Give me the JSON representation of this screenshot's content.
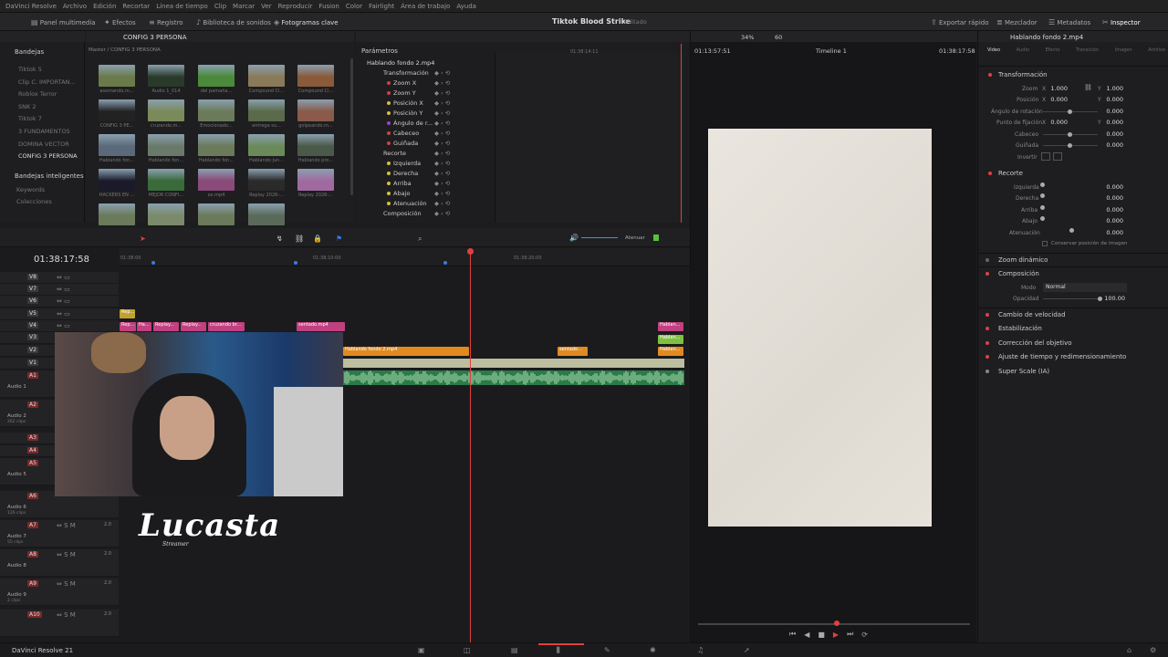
{
  "menu": [
    "DaVinci Resolve",
    "Archivo",
    "Edición",
    "Recortar",
    "Línea de tiempo",
    "Clip",
    "Marcar",
    "Ver",
    "Reproducir",
    "Fusion",
    "Color",
    "Fairlight",
    "Área de trabajo",
    "Ayuda"
  ],
  "topbar": {
    "media_pool": "Panel multimedia",
    "effects": "Efectos",
    "registry": "Registro",
    "sound_library": "Biblioteca de sonidos",
    "keyframes": "Fotogramas clave",
    "project_title": "Tiktok Blood Strike",
    "project_state": "Editado",
    "quick_export": "Exportar rápido",
    "mixer": "Mezclador",
    "metadata": "Metadatos",
    "inspector": "Inspector"
  },
  "bins": {
    "header": "Bandejas",
    "items": [
      "Tiktok 5",
      "Clip C. IMPORTAN...",
      "Roblox Terror",
      "SNK 2",
      "Tiktok 7",
      "3 FUNDAMENTOS",
      "DOMINA VECTOR",
      "CONFIG 3 PERSONA"
    ],
    "smart": "Bandejas inteligentes",
    "keywords": "Keywords",
    "collections": "Colecciones"
  },
  "media_pool": {
    "current_bin": "CONFIG 3 PERSONA",
    "path": "Master / CONFIG 3 PERSONA",
    "clips": [
      {
        "label": "asomando.m...",
        "color": "#6a7a4a"
      },
      {
        "label": "Audio 1_014",
        "color": "#2a3a2a"
      },
      {
        "label": "del pamaña...",
        "color": "#4a8a3a"
      },
      {
        "label": "Compound Cl...",
        "color": "#8a7a5a"
      },
      {
        "label": "Compound Cl...",
        "color": "#8a5a3a"
      },
      {
        "label": "CONFIG 3 PE...",
        "color": "#222"
      },
      {
        "label": "cruzando.m...",
        "color": "#7a8a5a"
      },
      {
        "label": "Emocionado...",
        "color": "#6a7a5a"
      },
      {
        "label": "entrega su...",
        "color": "#5a6a4a"
      },
      {
        "label": "golpeando.m...",
        "color": "#8a5a4a"
      },
      {
        "label": "Hablando fon...",
        "color": "#5a6a7a"
      },
      {
        "label": "Hablando fon...",
        "color": "#6a7a6a"
      },
      {
        "label": "Hablando fon...",
        "color": "#6a7a5a"
      },
      {
        "label": "Hablando jun...",
        "color": "#6a8a5a"
      },
      {
        "label": "Hablando pro...",
        "color": "#4a5a4a"
      },
      {
        "label": "HACKERS EN ...",
        "color": "#1a1a2a"
      },
      {
        "label": "MEJOR CONFI...",
        "color": "#3a6a3a"
      },
      {
        "label": "ox.mp4",
        "color": "#8a4a7a"
      },
      {
        "label": "Replay 2026-...",
        "color": "#2a2a2a"
      },
      {
        "label": "Replay 2026-...",
        "color": "#a06aa0"
      },
      {
        "label": "",
        "color": "#6a7a5a"
      },
      {
        "label": "",
        "color": "#7a8a6a"
      },
      {
        "label": "",
        "color": "#6a7a5a"
      },
      {
        "label": "",
        "color": "#5a6a5a"
      }
    ]
  },
  "params": {
    "header": "Parámetros",
    "clip": "Hablando fondo 2.mp4",
    "ruler_time": "01:38:14:11",
    "items": [
      {
        "label": "Transformación",
        "color": "",
        "group": true
      },
      {
        "label": "Zoom X",
        "color": "#d04040",
        "group": false
      },
      {
        "label": "Zoom Y",
        "color": "#d04040",
        "group": false
      },
      {
        "label": "Posición X",
        "color": "#d0c040",
        "group": false
      },
      {
        "label": "Posición Y",
        "color": "#d0c040",
        "group": false
      },
      {
        "label": "Ángulo de r...",
        "color": "#a040d0",
        "group": false
      },
      {
        "label": "Cabeceo",
        "color": "#d04040",
        "group": false
      },
      {
        "label": "Guiñada",
        "color": "#d04040",
        "group": false
      },
      {
        "label": "Recorte",
        "color": "",
        "group": true
      },
      {
        "label": "Izquierda",
        "color": "#d0c040",
        "group": false
      },
      {
        "label": "Derecha",
        "color": "#d0c040",
        "group": false
      },
      {
        "label": "Arriba",
        "color": "#d0c040",
        "group": false
      },
      {
        "label": "Abajo",
        "color": "#d0c040",
        "group": false
      },
      {
        "label": "Atenuación",
        "color": "#d0c040",
        "group": false
      },
      {
        "label": "Composición",
        "color": "",
        "group": true
      }
    ]
  },
  "viewer": {
    "zoom": "34%",
    "fps": "60",
    "source_tc": "01:13:57:51",
    "timeline_name": "Timeline 1",
    "record_tc": "01:38:17:58"
  },
  "timeline": {
    "timecode": "01:38:17:58",
    "attenuate": "Atenuar",
    "ruler": [
      "01:38:00",
      "01:38:10:00",
      "01:38:20:00"
    ],
    "video_tracks": [
      "V8",
      "V7",
      "V6",
      "V5",
      "V4",
      "V3",
      "V2",
      "V1"
    ],
    "audio_tracks": [
      {
        "id": "A1",
        "name": "Audio 1",
        "sub": ""
      },
      {
        "id": "A2",
        "name": "Audio 2",
        "sub": "262 clips"
      },
      {
        "id": "A3",
        "name": "",
        "sub": ""
      },
      {
        "id": "A4",
        "name": "",
        "sub": ""
      },
      {
        "id": "A5",
        "name": "Audio 5",
        "sub": ""
      },
      {
        "id": "A6",
        "name": "Audio 6",
        "sub": "126 clips"
      },
      {
        "id": "A7",
        "name": "Audio 7",
        "sub": "55 clips"
      },
      {
        "id": "A8",
        "name": "Audio 8",
        "sub": ""
      },
      {
        "id": "A9",
        "name": "Audio 9",
        "sub": "2 clips"
      },
      {
        "id": "A10",
        "name": "",
        "sub": ""
      }
    ],
    "audio_level": "2.0",
    "clips": {
      "v5a": "Rep...",
      "v4a": "Rep...",
      "v4b": "Ha...",
      "v4c": "Replay...",
      "v4d": "Replay...",
      "v4e": "cruzando br...",
      "v4f": "sentado.mp4",
      "v4g": "Hablan...",
      "v3a": "Hablan...",
      "v2a": "Hablando fondo 2.mp4",
      "v2b": "sentado...",
      "v2c": "Hablan..."
    }
  },
  "inspector": {
    "clip": "Hablando fondo 2.mp4",
    "tabs": [
      "Video",
      "Audio",
      "Efecto",
      "Transición",
      "Imagen",
      "Archivo"
    ],
    "transform": {
      "title": "Transformación",
      "zoom_label": "Zoom",
      "zoom_x": "1.000",
      "zoom_y": "1.000",
      "position_label": "Posición",
      "pos_x": "0.000",
      "pos_y": "0.000",
      "rotation_label": "Ángulo de rotación",
      "rotation": "0.000",
      "anchor_label": "Punto de fijación",
      "anchor_x": "0.000",
      "anchor_y": "0.000",
      "pitch_label": "Cabeceo",
      "pitch": "0.000",
      "yaw_label": "Guiñada",
      "yaw": "0.000",
      "flip_label": "Invertir"
    },
    "crop": {
      "title": "Recorte",
      "left_label": "Izquierda",
      "left": "0.000",
      "right_label": "Derecha",
      "right": "0.000",
      "top_label": "Arriba",
      "top": "0.000",
      "bottom_label": "Abajo",
      "bottom": "0.000",
      "soft_label": "Atenuación",
      "soft": "0.000",
      "retain": "Conservar posición de imagen"
    },
    "dynamic_zoom": "Zoom dinámico",
    "composite": {
      "title": "Composición",
      "mode_label": "Modo",
      "mode": "Normal",
      "opacity_label": "Opacidad",
      "opacity": "100.00"
    },
    "sections": [
      "Cambio de velocidad",
      "Estabilización",
      "Corrección del objetivo",
      "Ajuste de tiempo y redimensionamiento",
      "Super Scale (IA)"
    ]
  },
  "overlay": {
    "logo": "Lucasta",
    "sub": "Streamer"
  },
  "bottom": {
    "app": "DaVinci Resolve 21"
  }
}
